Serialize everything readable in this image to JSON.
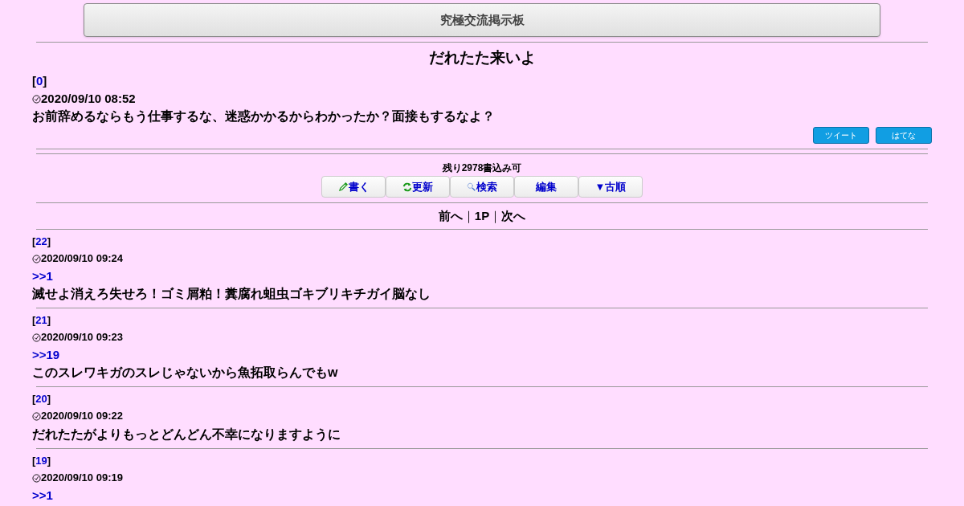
{
  "header": {
    "title": "究極交流掲示板"
  },
  "thread": {
    "title": "だれたた来いよ",
    "open": "[",
    "number": "0",
    "close": "]",
    "time": "2020/09/10 08:52",
    "body": "お前辞めるならもう仕事するな、迷惑かかるからわかったか？面接もするなよ？"
  },
  "share_buttons": [
    "ツイート",
    "はてな"
  ],
  "remaining": "残り2978書込み可",
  "toolbar": [
    {
      "kind": "write",
      "label": "書く"
    },
    {
      "kind": "refresh",
      "label": "更新"
    },
    {
      "kind": "search",
      "label": "検索"
    },
    {
      "kind": "plain",
      "label": "編集"
    },
    {
      "kind": "plain",
      "label": "▼古順"
    }
  ],
  "pager": [
    {
      "kind": "link",
      "text": "前へ"
    },
    {
      "kind": "sep",
      "text": "｜"
    },
    {
      "kind": "link",
      "text": "1P"
    },
    {
      "kind": "sep",
      "text": "｜"
    },
    {
      "kind": "link",
      "text": "次へ"
    }
  ],
  "posts": [
    {
      "open": "[",
      "number": "22",
      "close": "]",
      "time": "2020/09/10 09:24",
      "reply": ">>1",
      "body": "滅せよ消えろ失せろ！ゴミ屑粕！糞腐れ蛆虫ゴキブリキチガイ脳なし"
    },
    {
      "open": "[",
      "number": "21",
      "close": "]",
      "time": "2020/09/10 09:23",
      "reply": ">>19",
      "body": "このスレワキガのスレじゃないから魚拓取らんでもw"
    },
    {
      "open": "[",
      "number": "20",
      "close": "]",
      "time": "2020/09/10 09:22",
      "body": "だれたたがよりもっとどんどん不幸になりますように"
    },
    {
      "open": "[",
      "number": "19",
      "close": "]",
      "time": "2020/09/10 09:19",
      "reply": ">>1"
    }
  ]
}
